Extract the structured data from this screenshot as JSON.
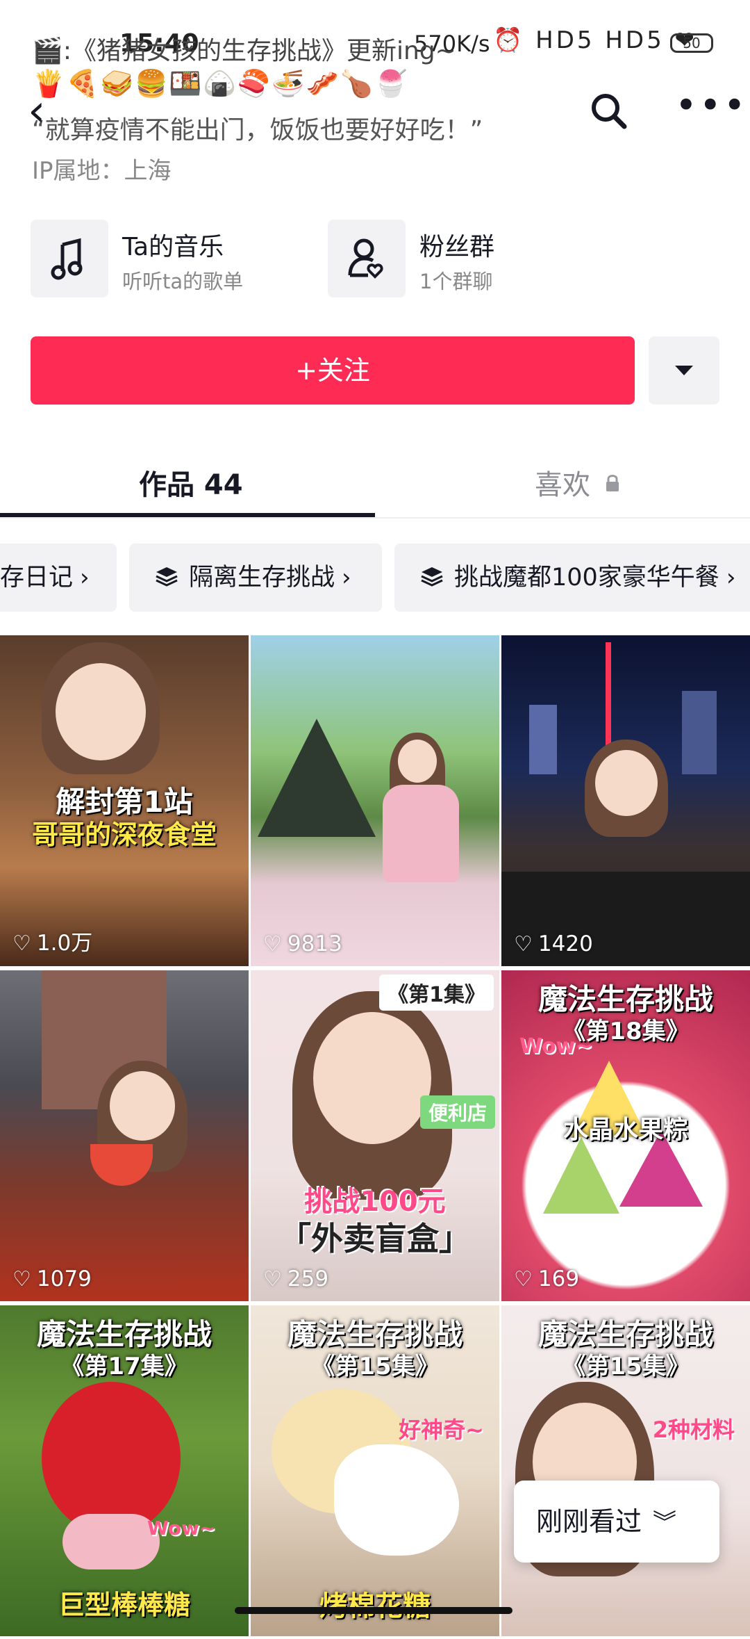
{
  "status": {
    "time": "15:40",
    "speed": "570K/s",
    "icons": "⏰ HD5 HD5 ❤",
    "battery": "50"
  },
  "bio": {
    "line1": "🎬:《猪猪女孩的生存挑战》更新ing~",
    "emojis": "🍟🍕🥪🍔🍱🍙🍣🍜🥓🍗🍧",
    "line3": "“就算疫情不能出门，饭饭也要好好吃！”",
    "ip": "IP属地：上海"
  },
  "icons": {
    "back": "chevron-left",
    "search": "search",
    "more": "more-dots",
    "music": "music-note",
    "fans": "user-heart",
    "lock": "lock",
    "collection": "layers"
  },
  "cards": [
    {
      "title": "Ta的音乐",
      "subtitle": "听听ta的歌单"
    },
    {
      "title": "粉丝群",
      "subtitle": "1个群聊"
    }
  ],
  "follow_label": "+关注",
  "tabs": {
    "works": "作品 44",
    "likes": "喜欢"
  },
  "collections": [
    "存日记",
    "隔离生存挑战",
    "挑战魔都100家豪华午餐"
  ],
  "videos": [
    {
      "caption1": "解封第1站",
      "caption2": "哥哥的深夜食堂",
      "likes": "1.0万"
    },
    {
      "caption1": "",
      "caption2": "",
      "likes": "9813"
    },
    {
      "caption1": "",
      "caption2": "",
      "likes": "1420"
    },
    {
      "caption1": "",
      "caption2": "",
      "likes": "1079"
    },
    {
      "caption1": "挑战100元",
      "caption2": "「外卖盲盒」",
      "tag": "《第1集》",
      "tag2": "便利店",
      "likes": "259"
    },
    {
      "caption1": "魔法生存挑战",
      "caption2": "《第18集》",
      "tag": "水晶水果粽",
      "tag2": "Wow~",
      "likes": "169"
    },
    {
      "caption1": "魔法生存挑战",
      "caption2": "《第17集》",
      "tag": "巨型棒棒糖",
      "tag2": "Wow~"
    },
    {
      "caption1": "魔法生存挑战",
      "caption2": "《第15集》",
      "tag": "烤棉花糖",
      "tag2": "好神奇~"
    },
    {
      "caption1": "魔法生存挑战",
      "caption2": "《第15集》",
      "tag2": "2种材料"
    }
  ],
  "recent_label": "刚刚看过",
  "colors": {
    "follow": "#fe2c55",
    "card_bg": "#f2f2f4",
    "text": "#161823",
    "muted": "#8a8b91"
  }
}
